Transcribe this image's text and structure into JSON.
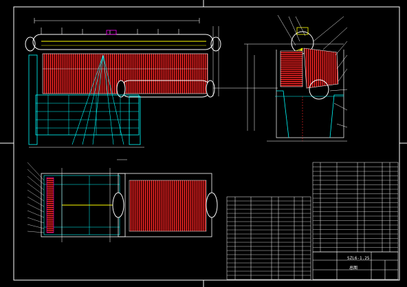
{
  "drawing": {
    "background": "#000000",
    "line_color": "#ffffff",
    "cyan": "#00ffff",
    "yellow": "#ffff00",
    "red": "#ff2a2a",
    "magenta": "#ff00ff",
    "green": "#00ff00"
  },
  "title_block": {
    "model": "SZL6-1.25",
    "name": "总图"
  }
}
